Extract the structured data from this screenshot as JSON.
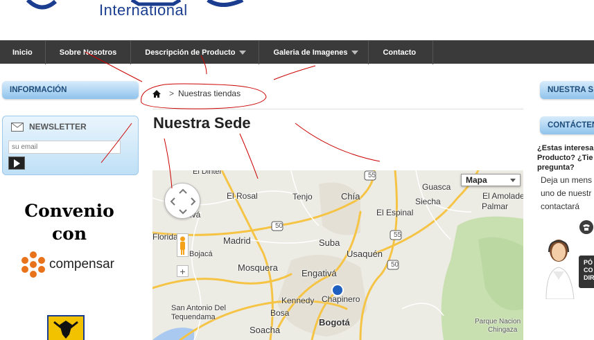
{
  "logo": {
    "text": "International"
  },
  "nav": {
    "items": [
      {
        "label": "Inicio",
        "dropdown": false
      },
      {
        "label": "Sobre Nosotros",
        "dropdown": false
      },
      {
        "label": "Descripción de Producto",
        "dropdown": true
      },
      {
        "label": "Galeria de Imagenes",
        "dropdown": true
      },
      {
        "label": "Contacto",
        "dropdown": false
      }
    ]
  },
  "sidebar_left": {
    "informacion_heading": "INFORMACIÓN",
    "newsletter": {
      "title": "NEWSLETTER",
      "email_placeholder": "su email"
    },
    "convenio_line1": "Convenio",
    "convenio_line2": "con",
    "compensar_label": "compensar"
  },
  "main": {
    "breadcrumb_sep": ">",
    "breadcrumb_current": "Nuestras tiendas",
    "title": "Nuestra Sede",
    "map": {
      "type_label": "Mapa",
      "zoom_in_label": "+",
      "labels": {
        "el_dintel": "El Dintel",
        "el_rosal": "El Rosal",
        "tenjo": "Tenjo",
        "chia": "Chía",
        "guasca": "Guasca",
        "el_amoladero": "El Amolade",
        "sopo_siecha": "Siecha",
        "el_espinal": "El Espinal",
        "palmar": "Palmar",
        "florida": "Florida",
        "bojaca": "Bojacá",
        "madrid": "Madrid",
        "mosquera": "Mosquera",
        "suba": "Suba",
        "usaquen": "Usaquén",
        "engativa": "Engativá",
        "kennedy": "Kennedy",
        "chapinero": "Chapinero",
        "san_antonio": "San Antonio Del",
        "tequendama": "Tequendama",
        "bosa": "Bosa",
        "bogota": "Bogotá",
        "soacha": "Soacha",
        "parque_line1": "Parque Nacion",
        "parque_line2": "Chingaza",
        "lativa": "rativá",
        "route_55a": "55",
        "route_55b": "55",
        "route_50a": "50",
        "route_50b": "50"
      }
    }
  },
  "sidebar_right": {
    "nuestra_heading": "NUESTRA S",
    "contacten_heading": "CONTÁCTEN",
    "question": "¿Estas interesa Producto? ¿Tie pregunta?",
    "body": "Deja un mens uno de nuestr contactará",
    "call_button": "PÓ CO DIR"
  },
  "colors": {
    "nav_bg": "#3a3a3a",
    "heading_blue": "#1d4c7a",
    "annotation_red": "#cc0000",
    "compensar_orange": "#e8731a"
  }
}
